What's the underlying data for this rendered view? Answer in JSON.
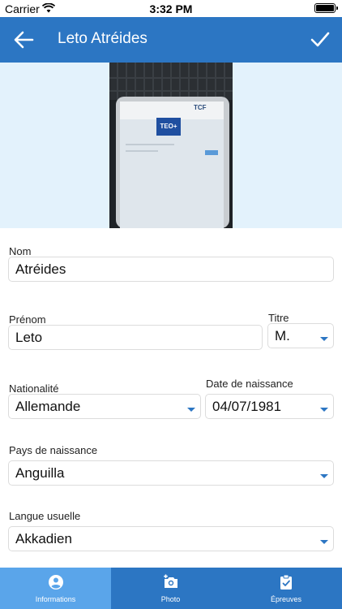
{
  "status_bar": {
    "carrier": "Carrier",
    "time": "3:32 PM"
  },
  "nav": {
    "title": "Leto Atréides"
  },
  "form": {
    "nom": {
      "label": "Nom",
      "value": "Atréides"
    },
    "prenom": {
      "label": "Prénom",
      "value": "Leto"
    },
    "titre": {
      "label": "Titre",
      "value": "M."
    },
    "nationalite": {
      "label": "Nationalité",
      "value": "Allemande"
    },
    "date_naissance": {
      "label": "Date de naissance",
      "value": "04/07/1981"
    },
    "pays_naissance": {
      "label": "Pays de naissance",
      "value": "Anguilla"
    },
    "langue_usuelle": {
      "label": "Langue usuelle",
      "value": "Akkadien"
    }
  },
  "photo": {
    "logo_text": "TEO+",
    "corner_text": "TCF"
  },
  "tabs": [
    {
      "label": "Informations",
      "icon": "person-circle-icon",
      "active": true
    },
    {
      "label": "Photo",
      "icon": "camera-add-icon",
      "active": false
    },
    {
      "label": "Épreuves",
      "icon": "clipboard-check-icon",
      "active": false
    }
  ],
  "colors": {
    "primary": "#2c76c3",
    "active_tab": "#5aa5ea",
    "photo_bg": "#e3f2fc"
  }
}
